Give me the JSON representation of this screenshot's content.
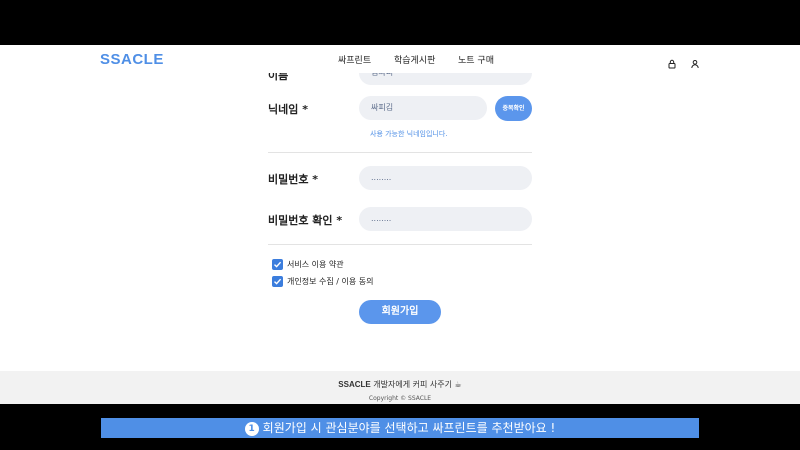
{
  "header": {
    "logo": "SSACLE",
    "nav": [
      "싸프린트",
      "학습게시판",
      "노트 구매"
    ],
    "icons": [
      "lock-icon",
      "user-icon"
    ]
  },
  "form": {
    "name": {
      "label": "이름",
      "value": "김싸피"
    },
    "nickname": {
      "label": "닉네임 *",
      "value": "싸피김",
      "check_button": "중복확인",
      "hint": "사용 가능한 닉네임입니다."
    },
    "password": {
      "label": "비밀번호 *",
      "value": "........"
    },
    "password_confirm": {
      "label": "비밀번호 확인 *",
      "value": "........"
    },
    "agreements": [
      {
        "label": "서비스 이용 약관",
        "checked": true
      },
      {
        "label": "개인정보 수집 / 이용 동의",
        "checked": true
      }
    ],
    "submit": "회원가입"
  },
  "footer": {
    "brand": "SSACLE",
    "tagline": "개발자에게 커피 사주기 ☕",
    "copyright": "Copyright © SSACLE"
  },
  "caption": {
    "number": "1",
    "text": "회원가입 시 관심분야를 선택하고 싸프린트를 추천받아요 !"
  },
  "colors": {
    "accent": "#4f8fe6",
    "button": "#5b96ec",
    "checkbox": "#3b7ddd",
    "field_bg": "#eef0f4"
  }
}
